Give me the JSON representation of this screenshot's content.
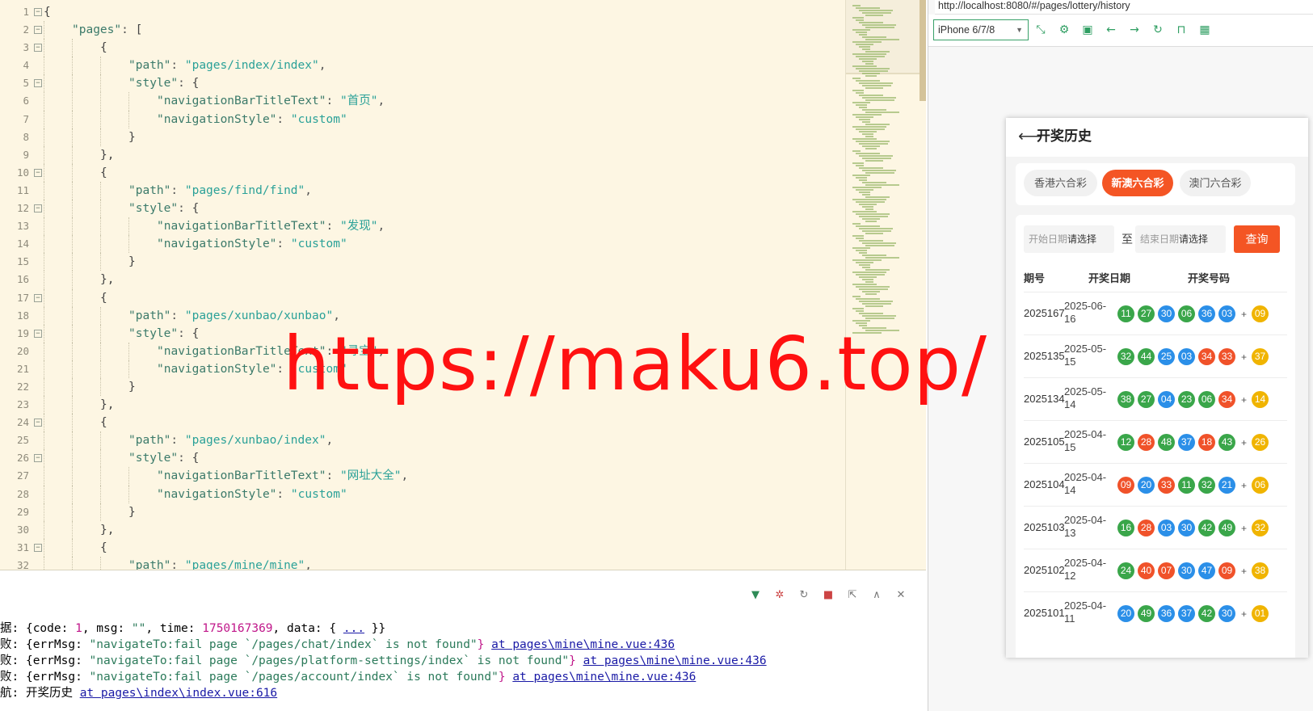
{
  "editor": {
    "lines": [
      {
        "n": "1",
        "fold": true,
        "segs": [
          [
            "b",
            "{"
          ]
        ],
        "ind": 0
      },
      {
        "n": "2",
        "fold": true,
        "segs": [
          [
            "k",
            "\"pages\""
          ],
          [
            "p",
            ": "
          ],
          [
            "b",
            "["
          ]
        ],
        "ind": 1
      },
      {
        "n": "3",
        "fold": true,
        "segs": [
          [
            "b",
            "{"
          ]
        ],
        "ind": 2
      },
      {
        "n": "4",
        "fold": false,
        "segs": [
          [
            "k",
            "\"path\""
          ],
          [
            "p",
            ": "
          ],
          [
            "s",
            "\"pages/index/index\""
          ],
          [
            "p",
            ","
          ]
        ],
        "ind": 3
      },
      {
        "n": "5",
        "fold": true,
        "segs": [
          [
            "k",
            "\"style\""
          ],
          [
            "p",
            ": "
          ],
          [
            "b",
            "{"
          ]
        ],
        "ind": 3
      },
      {
        "n": "6",
        "fold": false,
        "segs": [
          [
            "k",
            "\"navigationBarTitleText\""
          ],
          [
            "p",
            ": "
          ],
          [
            "s",
            "\"首页\""
          ],
          [
            "p",
            ","
          ]
        ],
        "ind": 4
      },
      {
        "n": "7",
        "fold": false,
        "segs": [
          [
            "k",
            "\"navigationStyle\""
          ],
          [
            "p",
            ": "
          ],
          [
            "s",
            "\"custom\""
          ]
        ],
        "ind": 4
      },
      {
        "n": "8",
        "fold": false,
        "segs": [
          [
            "b",
            "}"
          ]
        ],
        "ind": 3
      },
      {
        "n": "9",
        "fold": false,
        "segs": [
          [
            "b",
            "},"
          ]
        ],
        "ind": 2
      },
      {
        "n": "10",
        "fold": true,
        "segs": [
          [
            "b",
            "{"
          ]
        ],
        "ind": 2
      },
      {
        "n": "11",
        "fold": false,
        "segs": [
          [
            "k",
            "\"path\""
          ],
          [
            "p",
            ": "
          ],
          [
            "s",
            "\"pages/find/find\""
          ],
          [
            "p",
            ","
          ]
        ],
        "ind": 3
      },
      {
        "n": "12",
        "fold": true,
        "segs": [
          [
            "k",
            "\"style\""
          ],
          [
            "p",
            ": "
          ],
          [
            "b",
            "{"
          ]
        ],
        "ind": 3
      },
      {
        "n": "13",
        "fold": false,
        "segs": [
          [
            "k",
            "\"navigationBarTitleText\""
          ],
          [
            "p",
            ": "
          ],
          [
            "s",
            "\"发现\""
          ],
          [
            "p",
            ","
          ]
        ],
        "ind": 4
      },
      {
        "n": "14",
        "fold": false,
        "segs": [
          [
            "k",
            "\"navigationStyle\""
          ],
          [
            "p",
            ": "
          ],
          [
            "s",
            "\"custom\""
          ]
        ],
        "ind": 4
      },
      {
        "n": "15",
        "fold": false,
        "segs": [
          [
            "b",
            "}"
          ]
        ],
        "ind": 3
      },
      {
        "n": "16",
        "fold": false,
        "segs": [
          [
            "b",
            "},"
          ]
        ],
        "ind": 2
      },
      {
        "n": "17",
        "fold": true,
        "segs": [
          [
            "b",
            "{"
          ]
        ],
        "ind": 2
      },
      {
        "n": "18",
        "fold": false,
        "segs": [
          [
            "k",
            "\"path\""
          ],
          [
            "p",
            ": "
          ],
          [
            "s",
            "\"pages/xunbao/xunbao\""
          ],
          [
            "p",
            ","
          ]
        ],
        "ind": 3
      },
      {
        "n": "19",
        "fold": true,
        "segs": [
          [
            "k",
            "\"style\""
          ],
          [
            "p",
            ": "
          ],
          [
            "b",
            "{"
          ]
        ],
        "ind": 3
      },
      {
        "n": "20",
        "fold": false,
        "segs": [
          [
            "k",
            "\"navigationBarTitleText\""
          ],
          [
            "p",
            ": "
          ],
          [
            "s",
            "\"寻宝\""
          ],
          [
            "p",
            ","
          ]
        ],
        "ind": 4
      },
      {
        "n": "21",
        "fold": false,
        "segs": [
          [
            "k",
            "\"navigationStyle\""
          ],
          [
            "p",
            ": "
          ],
          [
            "s",
            "\"custom\""
          ]
        ],
        "ind": 4
      },
      {
        "n": "22",
        "fold": false,
        "segs": [
          [
            "b",
            "}"
          ]
        ],
        "ind": 3
      },
      {
        "n": "23",
        "fold": false,
        "segs": [
          [
            "b",
            "},"
          ]
        ],
        "ind": 2
      },
      {
        "n": "24",
        "fold": true,
        "segs": [
          [
            "b",
            "{"
          ]
        ],
        "ind": 2
      },
      {
        "n": "25",
        "fold": false,
        "segs": [
          [
            "k",
            "\"path\""
          ],
          [
            "p",
            ": "
          ],
          [
            "s",
            "\"pages/xunbao/index\""
          ],
          [
            "p",
            ","
          ]
        ],
        "ind": 3
      },
      {
        "n": "26",
        "fold": true,
        "segs": [
          [
            "k",
            "\"style\""
          ],
          [
            "p",
            ": "
          ],
          [
            "b",
            "{"
          ]
        ],
        "ind": 3
      },
      {
        "n": "27",
        "fold": false,
        "segs": [
          [
            "k",
            "\"navigationBarTitleText\""
          ],
          [
            "p",
            ": "
          ],
          [
            "s",
            "\"网址大全\""
          ],
          [
            "p",
            ","
          ]
        ],
        "ind": 4
      },
      {
        "n": "28",
        "fold": false,
        "segs": [
          [
            "k",
            "\"navigationStyle\""
          ],
          [
            "p",
            ": "
          ],
          [
            "s",
            "\"custom\""
          ]
        ],
        "ind": 4
      },
      {
        "n": "29",
        "fold": false,
        "segs": [
          [
            "b",
            "}"
          ]
        ],
        "ind": 3
      },
      {
        "n": "30",
        "fold": false,
        "segs": [
          [
            "b",
            "},"
          ]
        ],
        "ind": 2
      },
      {
        "n": "31",
        "fold": true,
        "segs": [
          [
            "b",
            "{"
          ]
        ],
        "ind": 2
      },
      {
        "n": "32",
        "fold": false,
        "segs": [
          [
            "k",
            "\"path\""
          ],
          [
            "p",
            ": "
          ],
          [
            "s",
            "\"pages/mine/mine\""
          ],
          [
            "p",
            ","
          ]
        ],
        "ind": 3
      }
    ]
  },
  "console": {
    "tools": [
      "vue-icon",
      "bug-icon",
      "refresh-icon",
      "stop-icon",
      "export-icon",
      "collapse-icon",
      "clear-icon"
    ],
    "logs": [
      [
        [
          "t",
          "据: {code: "
        ],
        [
          "n",
          "1"
        ],
        [
          "t",
          ", msg: "
        ],
        [
          "s",
          "\"\""
        ],
        [
          "t",
          ", time: "
        ],
        [
          "n",
          "1750167369"
        ],
        [
          "t",
          ", data: { "
        ],
        [
          "l",
          "..."
        ],
        [
          "t",
          " }}"
        ]
      ],
      [
        [
          "t",
          "败: {errMsg: "
        ],
        [
          "s",
          "\"navigateTo:fail page `/pages/chat/index` is not found\""
        ],
        [
          "b",
          "}"
        ],
        [
          "t",
          " "
        ],
        [
          "l",
          "at pages\\mine\\mine.vue:436"
        ]
      ],
      [
        [
          "t",
          "败: {errMsg: "
        ],
        [
          "s",
          "\"navigateTo:fail page `/pages/platform-settings/index` is not found\""
        ],
        [
          "b",
          "}"
        ],
        [
          "t",
          " "
        ],
        [
          "l",
          "at pages\\mine\\mine.vue:436"
        ]
      ],
      [
        [
          "t",
          "败: {errMsg: "
        ],
        [
          "s",
          "\"navigateTo:fail page `/pages/account/index` is not found\""
        ],
        [
          "b",
          "}"
        ],
        [
          "t",
          " "
        ],
        [
          "l",
          "at pages\\mine\\mine.vue:436"
        ]
      ],
      [
        [
          "t",
          "航: 开奖历史 "
        ],
        [
          "l",
          "at pages\\index\\index.vue:616"
        ]
      ]
    ]
  },
  "browser": {
    "url": "http://localhost:8080/#/pages/lottery/history",
    "device": "iPhone 6/7/8"
  },
  "phone": {
    "title": "开奖历史",
    "tabs": [
      "香港六合彩",
      "新澳六合彩",
      "澳门六合彩"
    ],
    "active_tab": 1,
    "start_label": "开始日期",
    "start_value": "请选择",
    "sep": "至",
    "end_label": "结束日期",
    "end_value": "请选择",
    "query": "查询",
    "headers": [
      "期号",
      "开奖日期",
      "开奖号码"
    ],
    "rows": [
      {
        "issue": "2025167",
        "date": "2025-06-16",
        "nums": [
          "11",
          "27",
          "30",
          "06",
          "36",
          "03"
        ],
        "colors": [
          "g",
          "g",
          "b",
          "g",
          "b",
          "b"
        ],
        "sp": "09"
      },
      {
        "issue": "2025135",
        "date": "2025-05-15",
        "nums": [
          "32",
          "44",
          "25",
          "03",
          "34",
          "33"
        ],
        "colors": [
          "g",
          "g",
          "b",
          "b",
          "r",
          "r"
        ],
        "sp": "37"
      },
      {
        "issue": "2025134",
        "date": "2025-05-14",
        "nums": [
          "38",
          "27",
          "04",
          "23",
          "06",
          "34"
        ],
        "colors": [
          "g",
          "g",
          "b",
          "g",
          "g",
          "r"
        ],
        "sp": "14"
      },
      {
        "issue": "2025105",
        "date": "2025-04-15",
        "nums": [
          "12",
          "28",
          "48",
          "37",
          "18",
          "43"
        ],
        "colors": [
          "g",
          "r",
          "g",
          "b",
          "r",
          "g"
        ],
        "sp": "26"
      },
      {
        "issue": "2025104",
        "date": "2025-04-14",
        "nums": [
          "09",
          "20",
          "33",
          "11",
          "32",
          "21"
        ],
        "colors": [
          "r",
          "b",
          "r",
          "g",
          "g",
          "b"
        ],
        "sp": "06"
      },
      {
        "issue": "2025103",
        "date": "2025-04-13",
        "nums": [
          "16",
          "28",
          "03",
          "30",
          "42",
          "49"
        ],
        "colors": [
          "g",
          "r",
          "b",
          "b",
          "g",
          "g"
        ],
        "sp": "32"
      },
      {
        "issue": "2025102",
        "date": "2025-04-12",
        "nums": [
          "24",
          "40",
          "07",
          "30",
          "47",
          "09"
        ],
        "colors": [
          "g",
          "r",
          "r",
          "b",
          "b",
          "r"
        ],
        "sp": "38"
      },
      {
        "issue": "2025101",
        "date": "2025-04-11",
        "nums": [
          "20",
          "49",
          "36",
          "37",
          "42",
          "30"
        ],
        "colors": [
          "b",
          "g",
          "b",
          "b",
          "g",
          "b"
        ],
        "sp": "01"
      }
    ],
    "ball_colors": {
      "g": "#3aa64a",
      "b": "#2b8fe8",
      "r": "#f0522a"
    }
  },
  "watermark": "https://maku6.top/"
}
